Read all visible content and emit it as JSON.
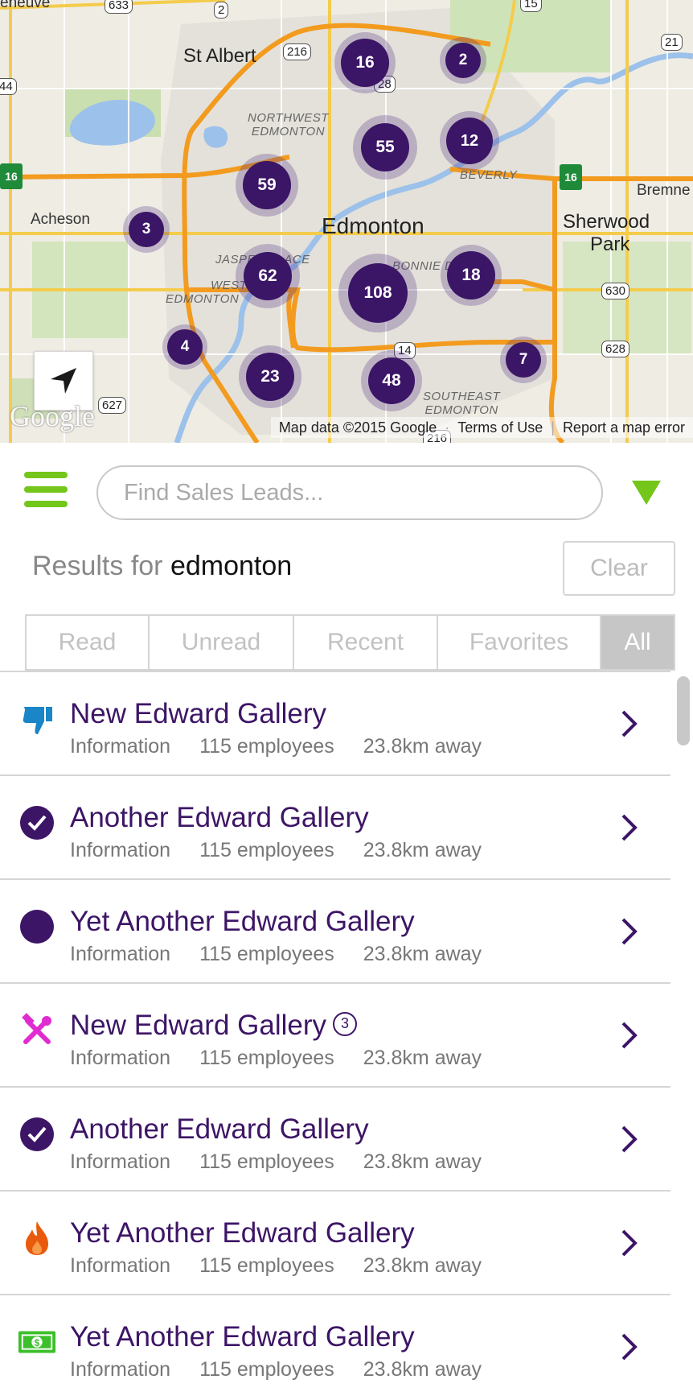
{
  "map": {
    "labels": {
      "city_main": "Edmonton",
      "st_albert": "St Albert",
      "sherwood_1": "Sherwood",
      "sherwood_2": "Park",
      "acheson": "Acheson",
      "bremner": "Bremne",
      "geneve": "eneuve",
      "nw_1": "NORTHWEST",
      "nw_2": "EDMONTON",
      "west_1": "WEST",
      "west_2": "EDMONTON",
      "se_1": "SOUTHEAST",
      "se_2": "EDMONTON",
      "beverly": "BEVERLY",
      "jasper": "JASPER PLACE",
      "bonnie": "BONNIE DOON"
    },
    "shields": [
      "633",
      "2",
      "15",
      "21",
      "216",
      "28",
      "44",
      "630",
      "628",
      "627",
      "14",
      "216"
    ],
    "hwy16": "16",
    "clusters": [
      {
        "count": "16"
      },
      {
        "count": "2"
      },
      {
        "count": "55"
      },
      {
        "count": "12"
      },
      {
        "count": "59"
      },
      {
        "count": "3"
      },
      {
        "count": "62"
      },
      {
        "count": "108"
      },
      {
        "count": "18"
      },
      {
        "count": "4"
      },
      {
        "count": "23"
      },
      {
        "count": "48"
      },
      {
        "count": "7"
      }
    ],
    "logo": "Google",
    "footer": {
      "data": "Map data ©2015 Google",
      "terms": "Terms of Use",
      "report": "Report a map error"
    }
  },
  "search": {
    "placeholder": "Find Sales Leads...",
    "results_prefix": "Results for",
    "query": "edmonton",
    "clear_label": "Clear"
  },
  "tabs": [
    {
      "label": "Read"
    },
    {
      "label": "Unread"
    },
    {
      "label": "Recent"
    },
    {
      "label": "Favorites"
    },
    {
      "label": "All",
      "active": true
    }
  ],
  "leads": [
    {
      "icon": "thumbs-down-icon",
      "title": "New Edward Gallery",
      "industry": "Information",
      "employees": "115 employees",
      "distance": "23.8km away"
    },
    {
      "icon": "check-circle-icon",
      "title": "Another Edward Gallery",
      "industry": "Information",
      "employees": "115 employees",
      "distance": "23.8km away"
    },
    {
      "icon": "filled-circle-icon",
      "title": "Yet Another Edward Gallery",
      "industry": "Information",
      "employees": "115 employees",
      "distance": "23.8km away"
    },
    {
      "icon": "tools-icon",
      "title": "New Edward Gallery",
      "badge": "3",
      "industry": "Information",
      "employees": "115 employees",
      "distance": "23.8km away"
    },
    {
      "icon": "check-circle-icon",
      "title": "Another Edward Gallery",
      "industry": "Information",
      "employees": "115 employees",
      "distance": "23.8km away"
    },
    {
      "icon": "flame-icon",
      "title": "Yet Another Edward Gallery",
      "industry": "Information",
      "employees": "115 employees",
      "distance": "23.8km away"
    },
    {
      "icon": "money-icon",
      "title": "Yet Another Edward Gallery",
      "industry": "Information",
      "employees": "115 employees",
      "distance": "23.8km away"
    }
  ],
  "colors": {
    "accent_green": "#74c61a",
    "brand_purple": "#3d1566",
    "icon_blue": "#1a86c8",
    "icon_magenta": "#e02bd0",
    "icon_orange": "#e85a0c",
    "icon_green": "#3bbf2a"
  }
}
